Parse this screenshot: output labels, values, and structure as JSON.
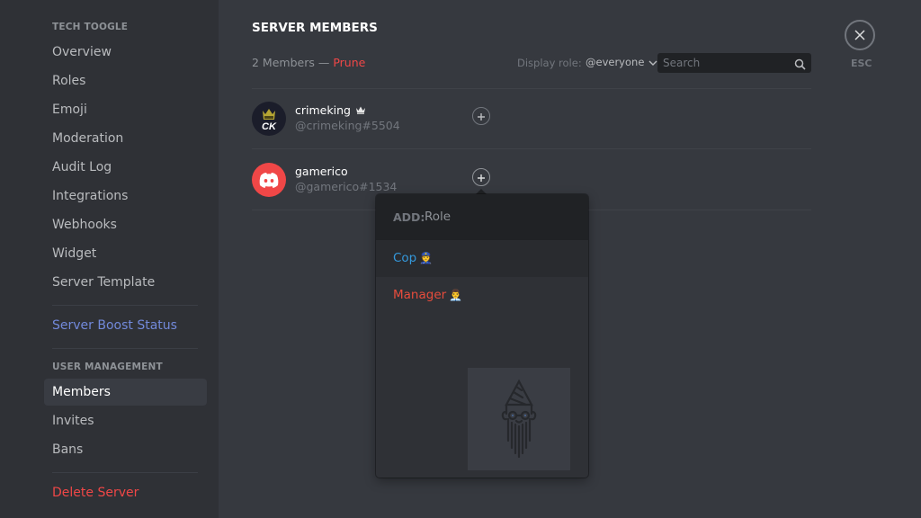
{
  "sidebar": {
    "server_header": "TECH TOOGLE",
    "items": [
      {
        "label": "Overview"
      },
      {
        "label": "Roles"
      },
      {
        "label": "Emoji"
      },
      {
        "label": "Moderation"
      },
      {
        "label": "Audit Log"
      },
      {
        "label": "Integrations"
      },
      {
        "label": "Webhooks"
      },
      {
        "label": "Widget"
      },
      {
        "label": "Server Template"
      }
    ],
    "boost_label": "Server Boost Status",
    "user_mgmt_header": "USER MANAGEMENT",
    "user_items": [
      {
        "label": "Members",
        "active": true
      },
      {
        "label": "Invites"
      },
      {
        "label": "Bans"
      }
    ],
    "delete_label": "Delete Server"
  },
  "main": {
    "title": "SERVER MEMBERS",
    "member_count": "2 Members",
    "separator": "—",
    "prune_label": "Prune",
    "display_role_label": "Display role:",
    "display_role_value": "@everyone",
    "search_placeholder": "Search",
    "esc_label": "ESC",
    "members": [
      {
        "name": "crimeking",
        "tag": "@crimeking#5504",
        "owner": true,
        "avatar_text": "CK"
      },
      {
        "name": "gamerico",
        "tag": "@gamerico#1534",
        "owner": false
      }
    ]
  },
  "role_popout": {
    "add_label": "ADD:",
    "input_placeholder": "Role",
    "roles": [
      {
        "name": "Cop",
        "emoji": "👮",
        "color": "#3498db"
      },
      {
        "name": "Manager",
        "emoji": "👨‍💼",
        "color": "#e74c3c"
      }
    ]
  },
  "colors": {
    "accent_blurple": "#7289da",
    "danger_red": "#f04747"
  }
}
